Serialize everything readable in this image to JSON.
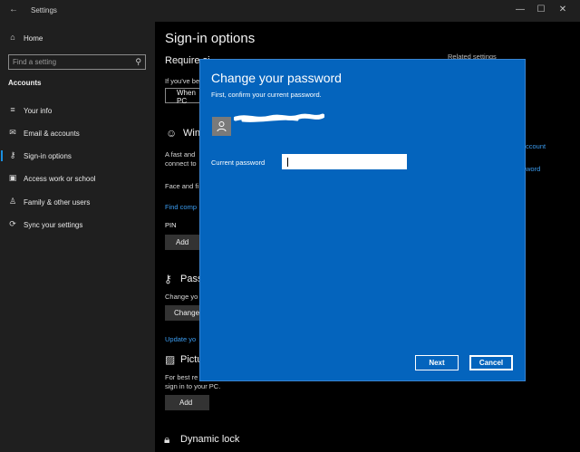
{
  "window": {
    "title": "Settings",
    "back_glyph": "←",
    "minimize_glyph": "—",
    "maximize_glyph": "☐",
    "close_glyph": "✕"
  },
  "sidebar": {
    "home_label": "Home",
    "search_placeholder": "Find a setting",
    "section_label": "Accounts",
    "items": [
      {
        "label": "Your info",
        "icon": "contact-card-icon"
      },
      {
        "label": "Email & accounts",
        "icon": "mail-icon"
      },
      {
        "label": "Sign-in options",
        "icon": "key-icon",
        "active": true
      },
      {
        "label": "Access work or school",
        "icon": "briefcase-icon"
      },
      {
        "label": "Family & other users",
        "icon": "people-icon"
      },
      {
        "label": "Sync your settings",
        "icon": "sync-icon"
      }
    ]
  },
  "main": {
    "title": "Sign-in options",
    "require_heading": "Require si",
    "require_text": "If you've be",
    "require_dropdown": "When PC",
    "related_settings": "Related settings",
    "related_link_1": "ccount",
    "related_link_2": "word",
    "windows_hello_heading": "Win",
    "hello_text_1": "A fast and",
    "hello_text_2": "connect to",
    "face_text": "Face and fi",
    "find_compatible_link": "Find comp",
    "pin_heading": "PIN",
    "pin_add_button": "Add",
    "password_heading": "Pass",
    "password_text": "Change yo",
    "password_change_button": "Change",
    "update_link": "Update yo",
    "picture_heading": "Pictu",
    "picture_text_1": "For best re",
    "picture_text_2": "sign in to your PC.",
    "picture_add_button": "Add",
    "dynamic_lock_heading": "Dynamic lock"
  },
  "dialog": {
    "title": "Change your password",
    "subtitle": "First, confirm your current password.",
    "user_icon": "user-icon",
    "current_password_label": "Current password",
    "current_password_value": "",
    "next_button": "Next",
    "cancel_button": "Cancel",
    "accent_color": "#0464bd"
  }
}
